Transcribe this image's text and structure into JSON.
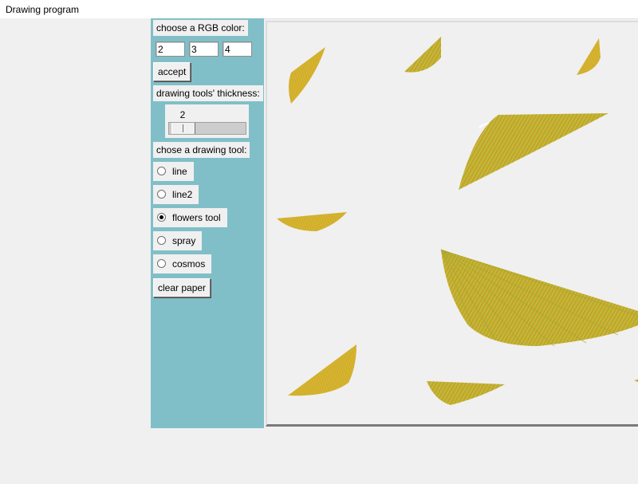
{
  "window": {
    "title": "Drawing program"
  },
  "color_section": {
    "label": "choose a RGB color:",
    "r": "2",
    "g": "3",
    "b": "4",
    "accept_label": "accept"
  },
  "thickness_section": {
    "label": "drawing tools' thickness:",
    "value": "2",
    "slider_fraction": 0.05
  },
  "tool_section": {
    "label": "chose a drawing tool:",
    "tools": [
      {
        "label": "line",
        "selected": false
      },
      {
        "label": "line2",
        "selected": false
      },
      {
        "label": "flowers tool",
        "selected": true
      },
      {
        "label": "spray",
        "selected": false
      },
      {
        "label": "cosmos",
        "selected": false
      }
    ],
    "clear_label": "clear paper"
  },
  "colors": {
    "panel_bg": "#81bfc8",
    "canvas_bg": "#f0f0f0",
    "stroke_yellow": "#d4b52c",
    "stroke_green": "#9fbf2e",
    "stroke_orange": "#e09a2a",
    "stroke_olive": "#a89a34"
  }
}
